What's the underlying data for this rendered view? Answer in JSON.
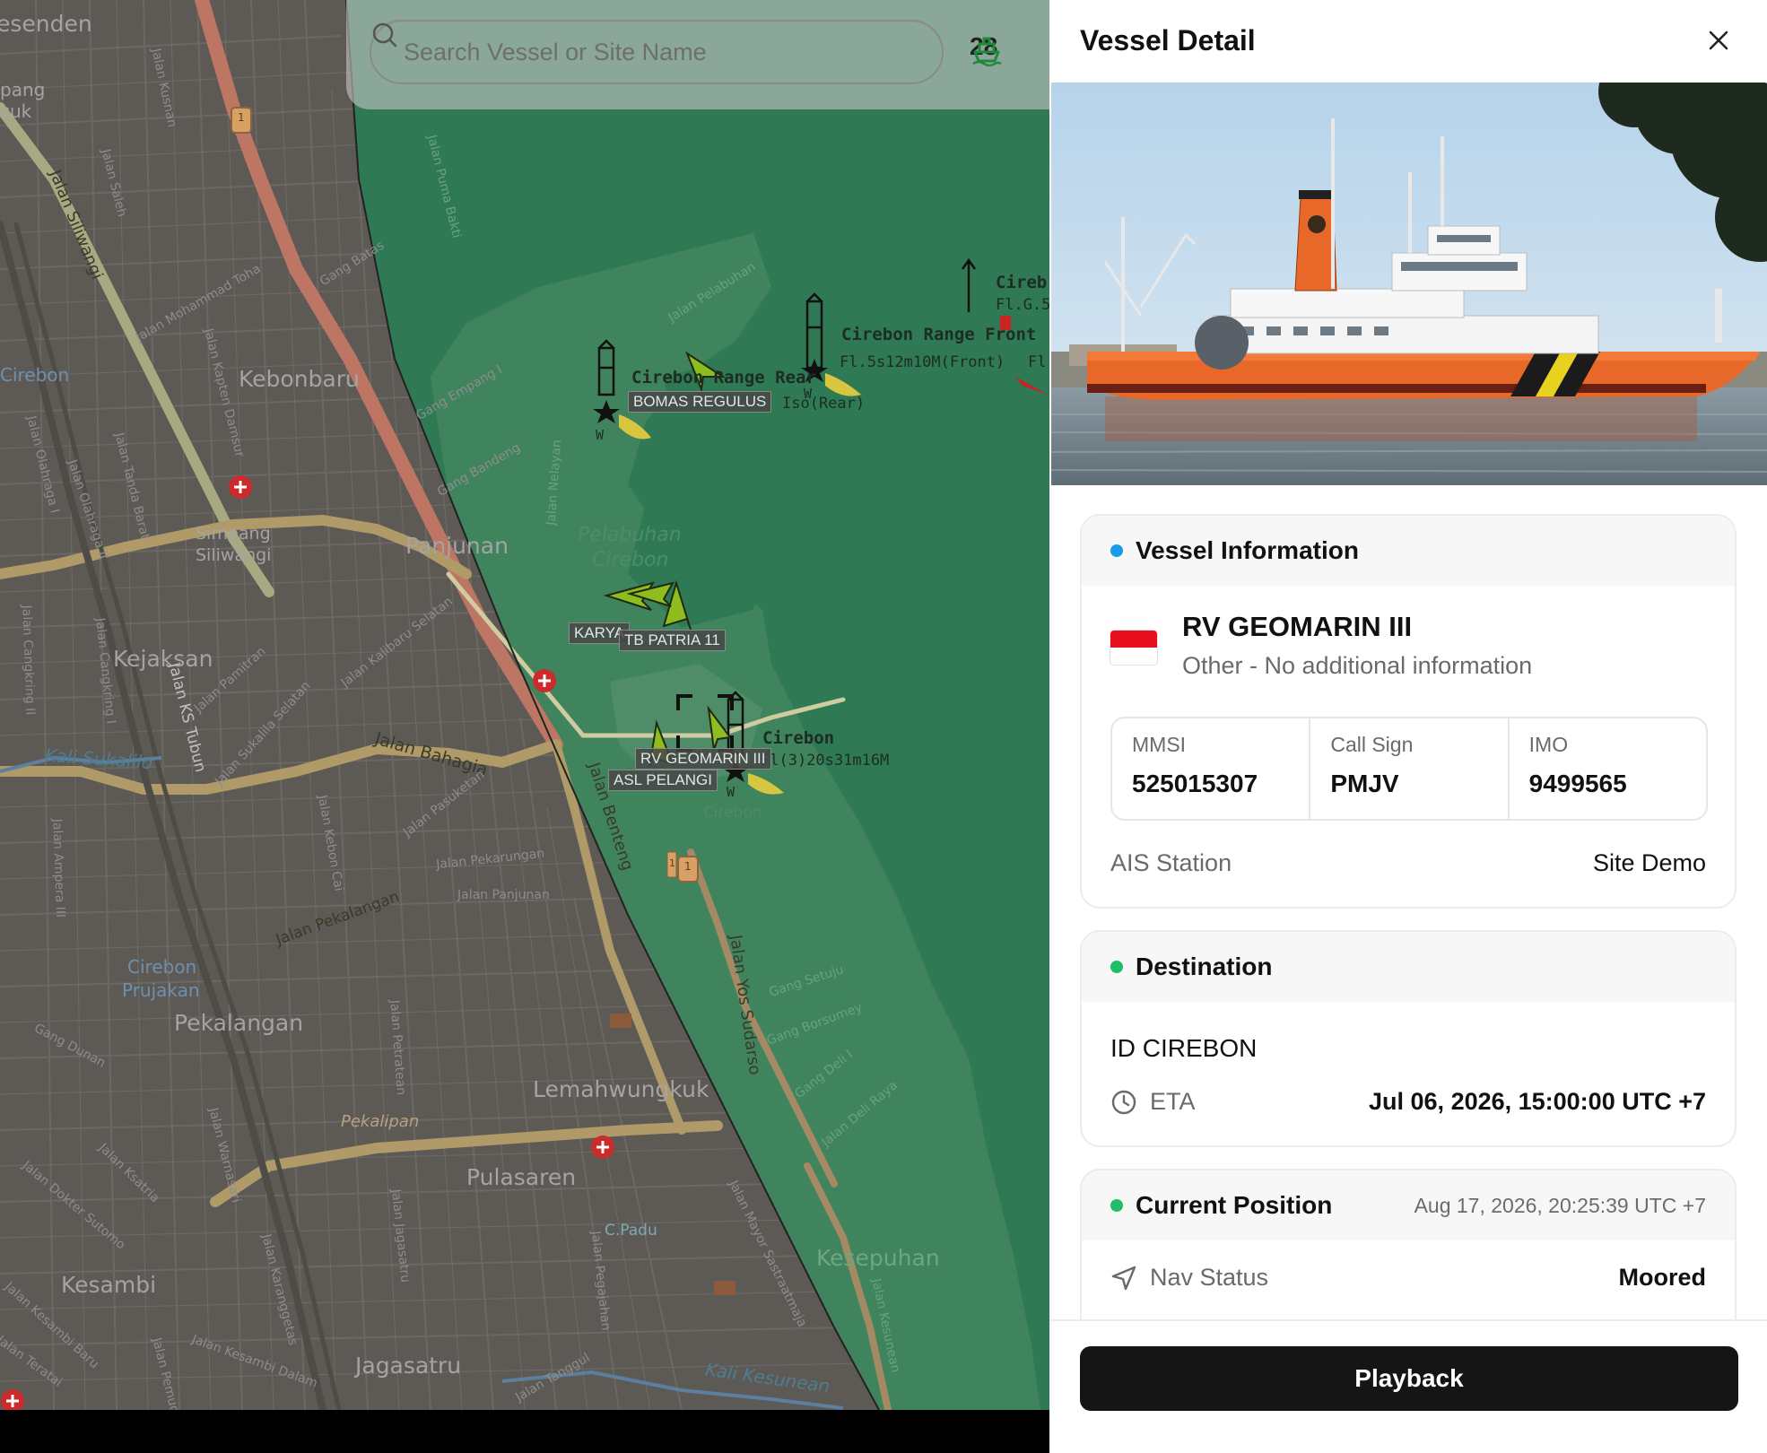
{
  "search": {
    "placeholder": "Search Vessel or Site Name"
  },
  "vessel_count": "28",
  "map": {
    "districts": [
      "esenden",
      "pang",
      "cuk",
      "Kebonbaru",
      "Panjunan",
      "Kejaksan",
      "Pekalangan",
      "Lemahwungkuk",
      "Pulasaren",
      "Kesambi",
      "Jagasatru",
      "Kesepuhan",
      "Simpang",
      "Siliwangi",
      "Cirebon",
      "Prujakan"
    ],
    "district_cirebon_left": "Cirebon",
    "streets": [
      "Jalan Siliwangi",
      "Jalan Kusnan",
      "Jalan Saleh",
      "Jalan Mohammad Toha",
      "Jalan Kapten Damsur",
      "Gang Batas",
      "Jalan Olahraga I",
      "Jalan Olahraga II",
      "Jalan Tanda Barat",
      "Jalan Cangkring II",
      "Jalan Cangkring I",
      "Jalan KS Tubun",
      "Jalan Pamitran",
      "Jalan Sukalila Selatan",
      "Jalan Kalibaru Selatan",
      "Jalan Bahagia",
      "Jalan Pekarungan",
      "Jalan Panjunan",
      "Jalan Pekalangan",
      "Jalan Kebon Cai",
      "Jalan Pasuketan",
      "Jalan Benteng",
      "Jalan Yos Sudarso",
      "Gang Setuju",
      "Gang Borsumey",
      "Gang Deli I",
      "Jalan Deli Raya",
      "Jalan Petratean",
      "Jalan Jagasatru",
      "Jalan Karanggetas",
      "Jalan Pegajahan",
      "Jalan Mayor Sastraatmaja",
      "Jalan Kesunean",
      "Jalan Ksatria",
      "Jalan Dokter Sutomo",
      "Gang Dunan",
      "Jalan Kesambi Baru",
      "Jalan Kesambi Dalam",
      "Jalan Teratai",
      "Jalan Ampera III",
      "Jalan Tanggul",
      "Jalan Nelayan",
      "Gang Empang I",
      "Gang Bandeng",
      "Jalan Pelabuhan",
      "Jalan Warnasari",
      "Jalan Pemuda",
      "Jalan Puma Bakti",
      "Pekalipan"
    ],
    "water": [
      "Kali Sukalilo",
      "Kali Kesunean"
    ],
    "port": [
      "Pelabuhan",
      "Cirebon"
    ],
    "nav_aids": [
      {
        "title": "Cirebon Range Rear",
        "sub": "Iso(Rear)"
      },
      {
        "title": "Cirebon Range Front",
        "sub": "Fl.5s12m10M(Front)"
      },
      {
        "title": "Cireb",
        "sub": "Fl.G.5"
      },
      {
        "title": "Cirebon",
        "sub": "Fl(3)20s31m16M"
      }
    ],
    "nav_aid_side_label": "Fl.",
    "lighthouse_mark": "W",
    "misc_labels": [
      "Cirebon",
      "C.Padu",
      "1",
      "1",
      "1"
    ],
    "vessels": [
      "BOMAS REGULUS",
      "KARYA",
      "TB PATRIA 11",
      "RV GEOMARIN III",
      "ASL PELANGI"
    ]
  },
  "panel": {
    "title": "Vessel Detail",
    "close_label": "×",
    "info_card": {
      "title": "Vessel Information",
      "dot_color": "#1a9be8",
      "name": "RV GEOMARIN III",
      "type": "Other - No additional information",
      "flag": "Indonesia",
      "ids": [
        {
          "label": "MMSI",
          "value": "525015307"
        },
        {
          "label": "Call Sign",
          "value": "PMJV"
        },
        {
          "label": "IMO",
          "value": "9499565"
        }
      ],
      "ais_station_label": "AIS Station",
      "ais_station_value": "Site Demo"
    },
    "destination_card": {
      "title": "Destination",
      "dot_color": "#1fbf6a",
      "destination": "ID CIREBON",
      "eta_label": "ETA",
      "eta_value": "Jul 06, 2026, 15:00:00 UTC +7"
    },
    "position_card": {
      "title": "Current Position",
      "dot_color": "#1fbf6a",
      "timestamp": "Aug 17, 2026, 20:25:39 UTC +7",
      "nav_status_label": "Nav Status",
      "nav_status_value": "Moored"
    },
    "playback_label": "Playback"
  },
  "colors": {
    "water": "#2f7a55",
    "land": "#5d5954",
    "road_primary": "#bd7564",
    "road_secondary": "#b09a68",
    "road_tertiary": "#a4a484",
    "hull": "#e8682a",
    "panel_button": "#151515"
  }
}
